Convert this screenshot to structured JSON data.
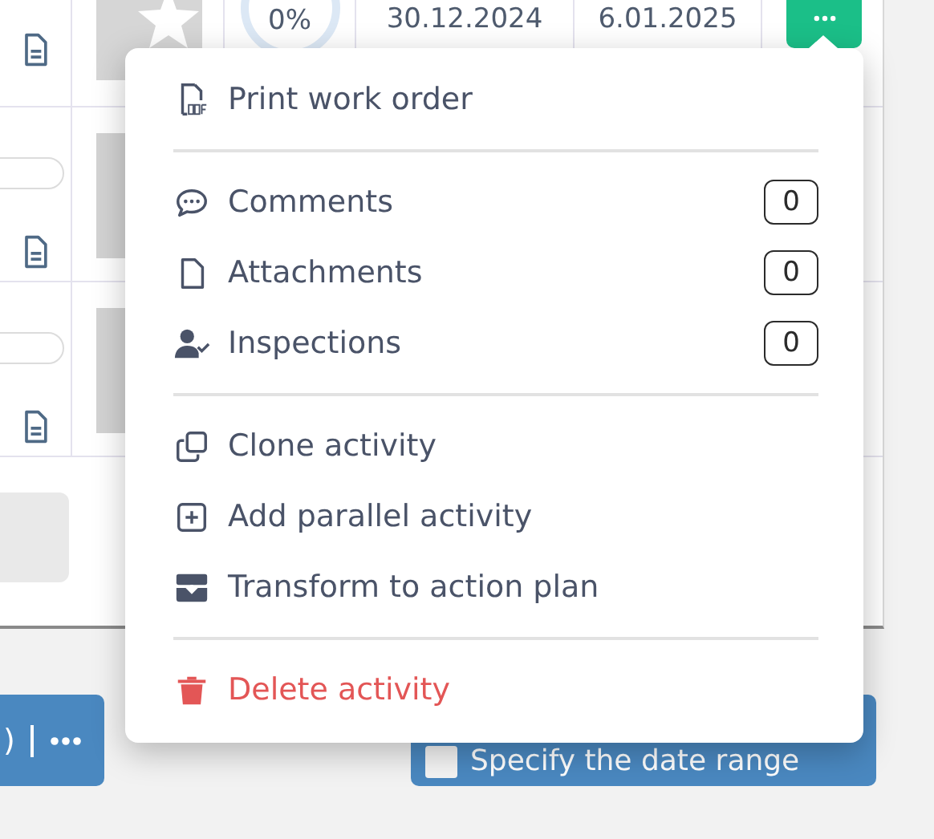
{
  "table": {
    "first_row": {
      "progress": "0%",
      "start_date": "30.12.2024",
      "end_date": "6.01.2025"
    }
  },
  "toolbar": {
    "left_button": {
      "text": ")"
    },
    "date_range": {
      "label": "Specify the date range",
      "checked": false
    }
  },
  "menu": {
    "sections": [
      {
        "items": [
          {
            "kind": "pdf",
            "label": "Print work order",
            "danger": false
          }
        ]
      },
      {
        "items": [
          {
            "kind": "comment",
            "label": "Comments",
            "count": "0",
            "danger": false
          },
          {
            "kind": "file",
            "label": "Attachments",
            "count": "0",
            "danger": false
          },
          {
            "kind": "person-check",
            "label": "Inspections",
            "count": "0",
            "danger": false
          }
        ]
      },
      {
        "items": [
          {
            "kind": "clone",
            "label": "Clone activity",
            "danger": false
          },
          {
            "kind": "plus-square",
            "label": "Add parallel activity",
            "danger": false
          },
          {
            "kind": "transform",
            "label": "Transform to action plan",
            "danger": false
          }
        ]
      },
      {
        "items": [
          {
            "kind": "trash",
            "label": "Delete activity",
            "danger": true
          }
        ]
      }
    ]
  }
}
